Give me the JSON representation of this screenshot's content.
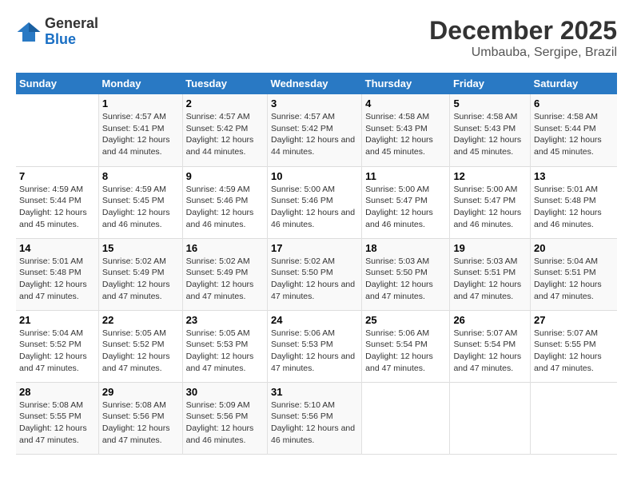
{
  "logo": {
    "general": "General",
    "blue": "Blue"
  },
  "header": {
    "month_year": "December 2025",
    "location": "Umbauba, Sergipe, Brazil"
  },
  "weekdays": [
    "Sunday",
    "Monday",
    "Tuesday",
    "Wednesday",
    "Thursday",
    "Friday",
    "Saturday"
  ],
  "weeks": [
    [
      {
        "day": "",
        "sunrise": "",
        "sunset": "",
        "daylight": ""
      },
      {
        "day": "1",
        "sunrise": "Sunrise: 4:57 AM",
        "sunset": "Sunset: 5:41 PM",
        "daylight": "Daylight: 12 hours and 44 minutes."
      },
      {
        "day": "2",
        "sunrise": "Sunrise: 4:57 AM",
        "sunset": "Sunset: 5:42 PM",
        "daylight": "Daylight: 12 hours and 44 minutes."
      },
      {
        "day": "3",
        "sunrise": "Sunrise: 4:57 AM",
        "sunset": "Sunset: 5:42 PM",
        "daylight": "Daylight: 12 hours and 44 minutes."
      },
      {
        "day": "4",
        "sunrise": "Sunrise: 4:58 AM",
        "sunset": "Sunset: 5:43 PM",
        "daylight": "Daylight: 12 hours and 45 minutes."
      },
      {
        "day": "5",
        "sunrise": "Sunrise: 4:58 AM",
        "sunset": "Sunset: 5:43 PM",
        "daylight": "Daylight: 12 hours and 45 minutes."
      },
      {
        "day": "6",
        "sunrise": "Sunrise: 4:58 AM",
        "sunset": "Sunset: 5:44 PM",
        "daylight": "Daylight: 12 hours and 45 minutes."
      }
    ],
    [
      {
        "day": "7",
        "sunrise": "Sunrise: 4:59 AM",
        "sunset": "Sunset: 5:44 PM",
        "daylight": "Daylight: 12 hours and 45 minutes."
      },
      {
        "day": "8",
        "sunrise": "Sunrise: 4:59 AM",
        "sunset": "Sunset: 5:45 PM",
        "daylight": "Daylight: 12 hours and 46 minutes."
      },
      {
        "day": "9",
        "sunrise": "Sunrise: 4:59 AM",
        "sunset": "Sunset: 5:46 PM",
        "daylight": "Daylight: 12 hours and 46 minutes."
      },
      {
        "day": "10",
        "sunrise": "Sunrise: 5:00 AM",
        "sunset": "Sunset: 5:46 PM",
        "daylight": "Daylight: 12 hours and 46 minutes."
      },
      {
        "day": "11",
        "sunrise": "Sunrise: 5:00 AM",
        "sunset": "Sunset: 5:47 PM",
        "daylight": "Daylight: 12 hours and 46 minutes."
      },
      {
        "day": "12",
        "sunrise": "Sunrise: 5:00 AM",
        "sunset": "Sunset: 5:47 PM",
        "daylight": "Daylight: 12 hours and 46 minutes."
      },
      {
        "day": "13",
        "sunrise": "Sunrise: 5:01 AM",
        "sunset": "Sunset: 5:48 PM",
        "daylight": "Daylight: 12 hours and 46 minutes."
      }
    ],
    [
      {
        "day": "14",
        "sunrise": "Sunrise: 5:01 AM",
        "sunset": "Sunset: 5:48 PM",
        "daylight": "Daylight: 12 hours and 47 minutes."
      },
      {
        "day": "15",
        "sunrise": "Sunrise: 5:02 AM",
        "sunset": "Sunset: 5:49 PM",
        "daylight": "Daylight: 12 hours and 47 minutes."
      },
      {
        "day": "16",
        "sunrise": "Sunrise: 5:02 AM",
        "sunset": "Sunset: 5:49 PM",
        "daylight": "Daylight: 12 hours and 47 minutes."
      },
      {
        "day": "17",
        "sunrise": "Sunrise: 5:02 AM",
        "sunset": "Sunset: 5:50 PM",
        "daylight": "Daylight: 12 hours and 47 minutes."
      },
      {
        "day": "18",
        "sunrise": "Sunrise: 5:03 AM",
        "sunset": "Sunset: 5:50 PM",
        "daylight": "Daylight: 12 hours and 47 minutes."
      },
      {
        "day": "19",
        "sunrise": "Sunrise: 5:03 AM",
        "sunset": "Sunset: 5:51 PM",
        "daylight": "Daylight: 12 hours and 47 minutes."
      },
      {
        "day": "20",
        "sunrise": "Sunrise: 5:04 AM",
        "sunset": "Sunset: 5:51 PM",
        "daylight": "Daylight: 12 hours and 47 minutes."
      }
    ],
    [
      {
        "day": "21",
        "sunrise": "Sunrise: 5:04 AM",
        "sunset": "Sunset: 5:52 PM",
        "daylight": "Daylight: 12 hours and 47 minutes."
      },
      {
        "day": "22",
        "sunrise": "Sunrise: 5:05 AM",
        "sunset": "Sunset: 5:52 PM",
        "daylight": "Daylight: 12 hours and 47 minutes."
      },
      {
        "day": "23",
        "sunrise": "Sunrise: 5:05 AM",
        "sunset": "Sunset: 5:53 PM",
        "daylight": "Daylight: 12 hours and 47 minutes."
      },
      {
        "day": "24",
        "sunrise": "Sunrise: 5:06 AM",
        "sunset": "Sunset: 5:53 PM",
        "daylight": "Daylight: 12 hours and 47 minutes."
      },
      {
        "day": "25",
        "sunrise": "Sunrise: 5:06 AM",
        "sunset": "Sunset: 5:54 PM",
        "daylight": "Daylight: 12 hours and 47 minutes."
      },
      {
        "day": "26",
        "sunrise": "Sunrise: 5:07 AM",
        "sunset": "Sunset: 5:54 PM",
        "daylight": "Daylight: 12 hours and 47 minutes."
      },
      {
        "day": "27",
        "sunrise": "Sunrise: 5:07 AM",
        "sunset": "Sunset: 5:55 PM",
        "daylight": "Daylight: 12 hours and 47 minutes."
      }
    ],
    [
      {
        "day": "28",
        "sunrise": "Sunrise: 5:08 AM",
        "sunset": "Sunset: 5:55 PM",
        "daylight": "Daylight: 12 hours and 47 minutes."
      },
      {
        "day": "29",
        "sunrise": "Sunrise: 5:08 AM",
        "sunset": "Sunset: 5:56 PM",
        "daylight": "Daylight: 12 hours and 47 minutes."
      },
      {
        "day": "30",
        "sunrise": "Sunrise: 5:09 AM",
        "sunset": "Sunset: 5:56 PM",
        "daylight": "Daylight: 12 hours and 46 minutes."
      },
      {
        "day": "31",
        "sunrise": "Sunrise: 5:10 AM",
        "sunset": "Sunset: 5:56 PM",
        "daylight": "Daylight: 12 hours and 46 minutes."
      },
      {
        "day": "",
        "sunrise": "",
        "sunset": "",
        "daylight": ""
      },
      {
        "day": "",
        "sunrise": "",
        "sunset": "",
        "daylight": ""
      },
      {
        "day": "",
        "sunrise": "",
        "sunset": "",
        "daylight": ""
      }
    ]
  ]
}
